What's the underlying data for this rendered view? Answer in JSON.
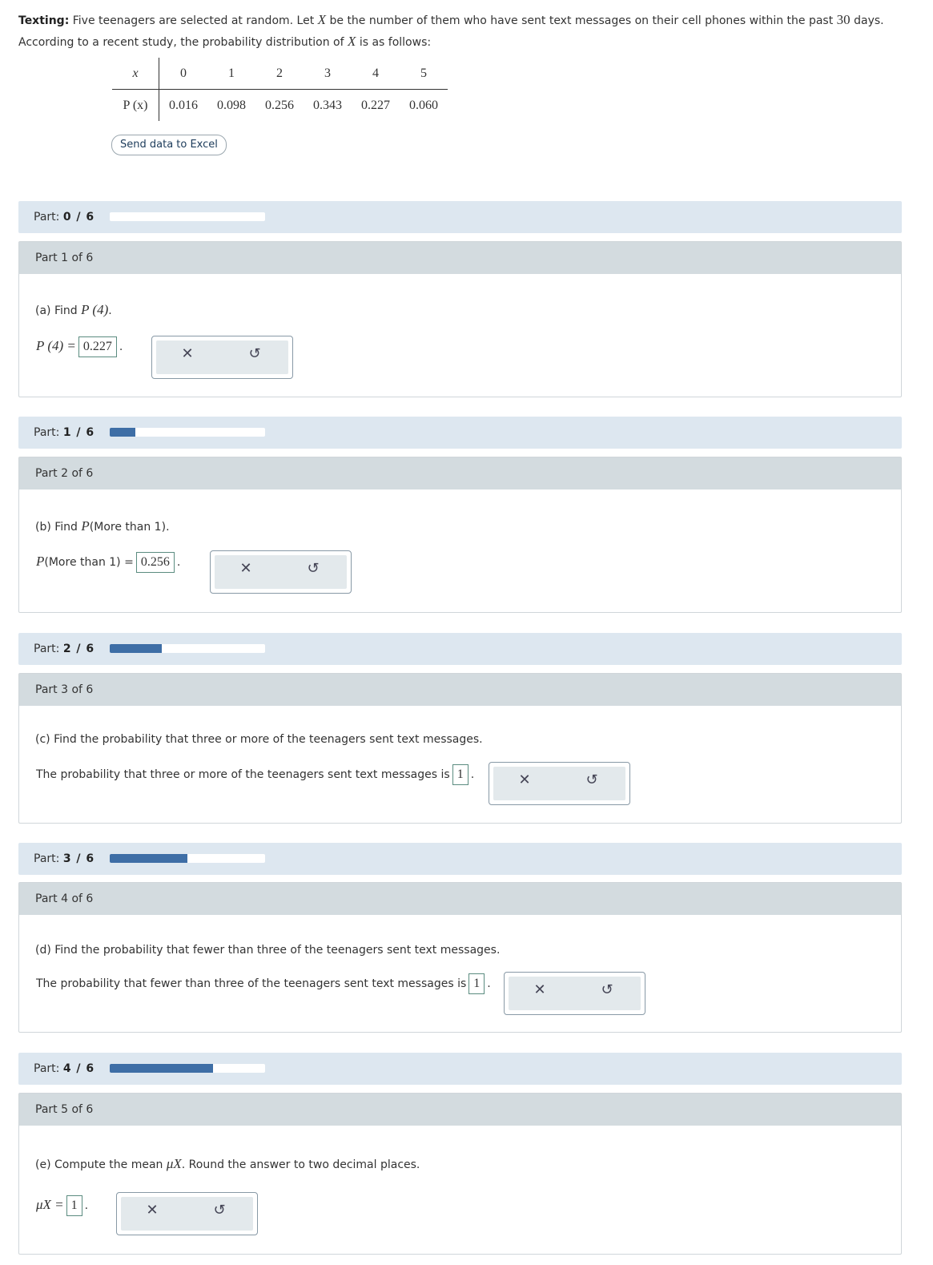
{
  "intro": {
    "bold": "Texting:",
    "text1": " Five teenagers are selected at random. Let ",
    "var": "X",
    "text2": " be the number of them who have sent text messages on their cell phones within the past ",
    "num": "30",
    "text3": " days.",
    "line2a": "According to a recent study, the probability distribution of ",
    "line2b": " is as follows:"
  },
  "table": {
    "x_label": "x",
    "p_label": "P (x)",
    "x_values": [
      "0",
      "1",
      "2",
      "3",
      "4",
      "5"
    ],
    "p_values": [
      "0.016",
      "0.098",
      "0.256",
      "0.343",
      "0.227",
      "0.060"
    ]
  },
  "excel_button": "Send data to Excel",
  "progress": [
    {
      "label": "Part:",
      "value": "0 / 6",
      "fraction": 0.0
    },
    {
      "label": "Part:",
      "value": "1 / 6",
      "fraction": 0.1667
    },
    {
      "label": "Part:",
      "value": "2 / 6",
      "fraction": 0.3333
    },
    {
      "label": "Part:",
      "value": "3 / 6",
      "fraction": 0.5
    },
    {
      "label": "Part:",
      "value": "4 / 6",
      "fraction": 0.6667
    }
  ],
  "parts": [
    {
      "header": "Part 1 of 6",
      "q_prefix": "(a) Find ",
      "q_math": "P (4)",
      "q_suffix": ".",
      "ans_prefix_math": "P (4) =",
      "ans_prefix": "",
      "answer": "0.227"
    },
    {
      "header": "Part 2 of 6",
      "q_prefix": "(b) Find ",
      "q_math": "P",
      "q_mid": "(More than 1)",
      "q_suffix": ".",
      "ans_prefix_math": "P",
      "ans_prefix": "(More than 1) =",
      "answer": "0.256"
    },
    {
      "header": "Part 3 of 6",
      "q_text": "(c) Find the probability that three or more of the teenagers sent text messages.",
      "ans_text": "The probability that three or more of the teenagers sent text messages is",
      "answer": "1"
    },
    {
      "header": "Part 4 of 6",
      "q_text": "(d) Find the probability that fewer than three of the teenagers sent text messages.",
      "ans_text": "The probability that fewer than three of the teenagers sent text messages is",
      "answer": "1"
    },
    {
      "header": "Part 5 of 6",
      "q_text1": "(e) Compute the mean ",
      "q_mu": "μX",
      "q_text2": ". Round the answer to two decimal places.",
      "ans_mu": "μX =",
      "answer": "1"
    }
  ],
  "icons": {
    "clear": "close-icon",
    "undo": "undo-icon"
  },
  "colors": {
    "progress_fill": "#3e6ea6",
    "progress_bg": "#dde7f0",
    "header_bg": "#d3dbdf"
  }
}
